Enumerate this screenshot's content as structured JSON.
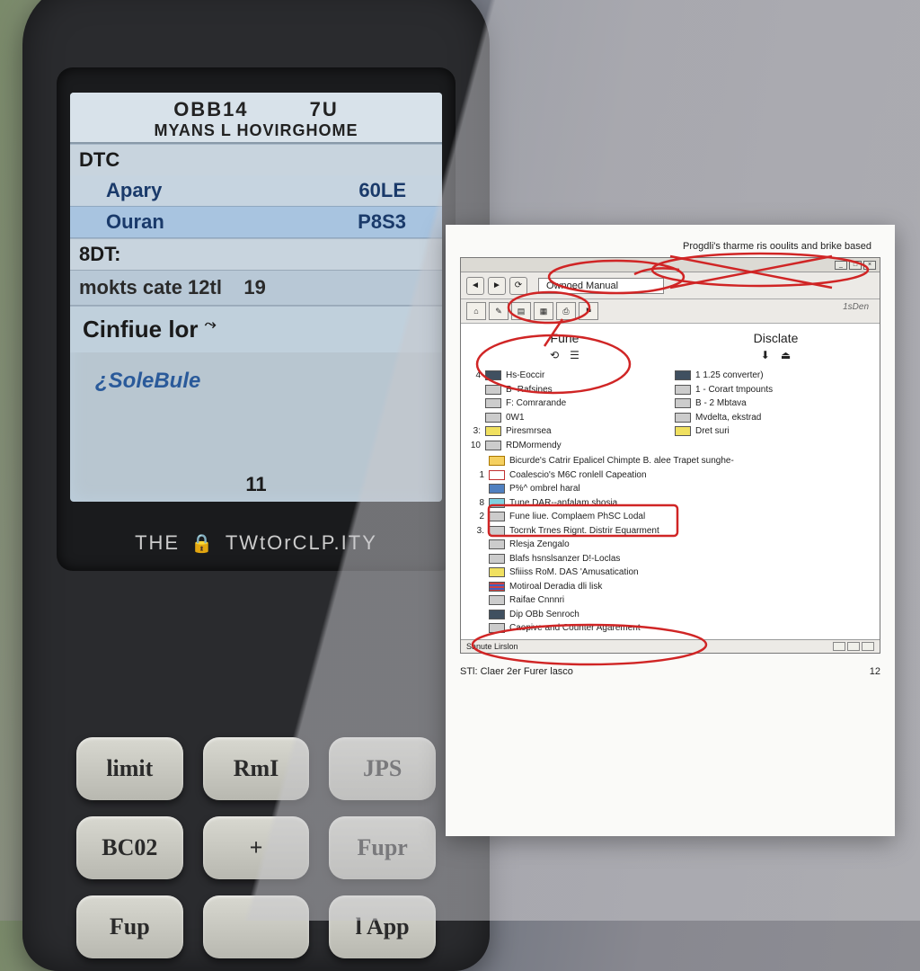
{
  "device": {
    "screen": {
      "title_line1_left": "OBB14",
      "title_line1_right": "7U",
      "title_line2": "MYANS L HOVIRGHOME",
      "section1_label": "DTC",
      "row1_left": "Apary",
      "row1_right": "60LE",
      "row2_left": "Ouran",
      "row2_right": "P8S3",
      "section2_label": "8DT:",
      "row3_left": "mokts cate 12tl",
      "row3_right": "19",
      "big_label": "Cinfiue   lor",
      "sole_label": "¿SoleBule",
      "footer_num": "11"
    },
    "watermark_left": "THE",
    "watermark_right": "TWtOrCLP.ITY",
    "keypad": [
      "limit",
      "RmI",
      "JPS",
      "BC02",
      "+",
      "Fupr",
      "Fup",
      "",
      "l App"
    ]
  },
  "paper": {
    "headline": "Progdli's tharme ris ooulits and brike based",
    "address_box": "Ownoed Manual",
    "toolbar_right": "1sDen",
    "col1_header": "Fune",
    "col2_header": "Disclate",
    "left_items": [
      {
        "n": "4",
        "t": "Hs-Eoccir"
      },
      {
        "n": "",
        "t": "B- Rafsines"
      },
      {
        "n": "",
        "t": "F: Comrarande"
      },
      {
        "n": "",
        "t": "0W1"
      },
      {
        "n": "3:",
        "t": "Piresmrsea"
      },
      {
        "n": "10",
        "t": "RDMormendy"
      }
    ],
    "right_items": [
      {
        "t": "1  1.25 converter)"
      },
      {
        "t": "1 - Corart tmpounts"
      },
      {
        "t": "B - 2 Mbtava"
      },
      {
        "t": "Mvdelta, ekstrad"
      },
      {
        "t": "Dret suri"
      }
    ],
    "long_items": [
      {
        "ic": "warn",
        "t": "Bicurde's Catrir Epalicel Chimpte B. alee Trapet sunghe-"
      },
      {
        "ic": "red",
        "n": "1",
        "t": "Coalescio's M6C  ronlell Capeation"
      },
      {
        "ic": "blue",
        "t": "P%^ ombrel haral"
      },
      {
        "ic": "cyan",
        "n": "8",
        "t": "Tune DAR--anfalam shosia"
      },
      {
        "ic": "grey",
        "n": "2",
        "t": "Fune liue. Complaem PhSC Lodal"
      },
      {
        "ic": "grey",
        "n": "3.",
        "t": "Tocrnk Trnes Rignt. Distrir Equarment"
      },
      {
        "ic": "grey",
        "t": "Rlesja Zengalo"
      },
      {
        "ic": "grey",
        "t": "Blafs  hsnslsanzer D!-Loclas"
      },
      {
        "ic": "yellow",
        "t": "Sfiiiss RoM. DAS   'Amusatication"
      },
      {
        "ic": "stripes",
        "t": "Motiroal Deradia  dli lisk"
      },
      {
        "ic": "grey",
        "t": "Raifae Cnnnri"
      },
      {
        "ic": "dark",
        "t": "Dip OBb Senroch"
      },
      {
        "ic": "grey",
        "t": "Caopive and Counter Agarement"
      }
    ],
    "statusbar_left": "Sanute Lirslon",
    "footer_left": "STl: Claer 2er Furer lasco",
    "footer_right": "12"
  }
}
